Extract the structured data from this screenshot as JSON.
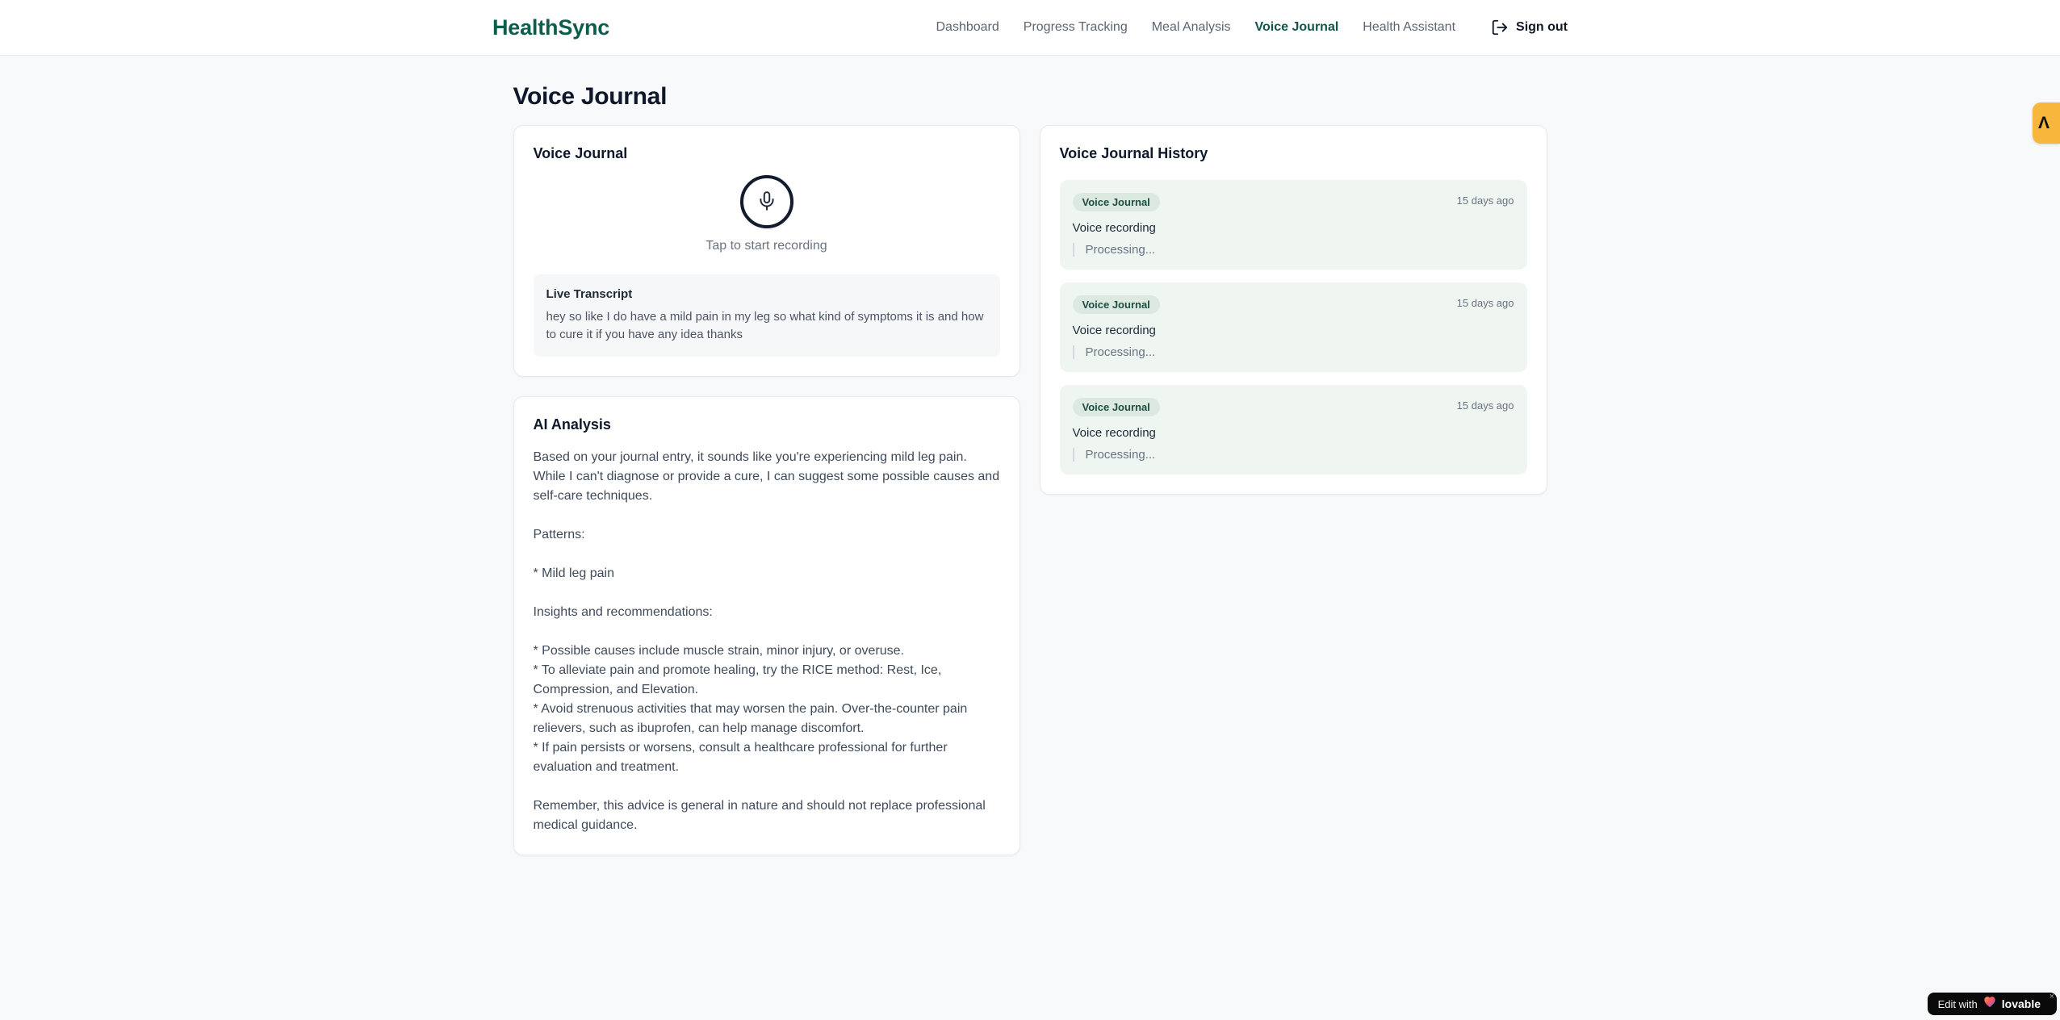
{
  "brand": {
    "name": "HealthSync",
    "color": "#0b5d4c"
  },
  "nav": {
    "items": [
      {
        "label": "Dashboard",
        "active": false
      },
      {
        "label": "Progress Tracking",
        "active": false
      },
      {
        "label": "Meal Analysis",
        "active": false
      },
      {
        "label": "Voice Journal",
        "active": true
      },
      {
        "label": "Health Assistant",
        "active": false
      }
    ],
    "signout_label": "Sign out"
  },
  "page": {
    "title": "Voice Journal"
  },
  "recorder_card": {
    "title": "Voice Journal",
    "tap_hint": "Tap to start recording",
    "transcript_title": "Live Transcript",
    "transcript_text": "hey so like I do have a mild pain in my leg so what kind of symptoms it is and how to cure it if you have any idea thanks"
  },
  "analysis_card": {
    "title": "AI Analysis",
    "body": "Based on your journal entry, it sounds like you're experiencing mild leg pain. While I can't diagnose or provide a cure, I can suggest some possible causes and self-care techniques.\n\nPatterns:\n\n* Mild leg pain\n\nInsights and recommendations:\n\n* Possible causes include muscle strain, minor injury, or overuse.\n* To alleviate pain and promote healing, try the RICE method: Rest, Ice, Compression, and Elevation.\n* Avoid strenuous activities that may worsen the pain. Over-the-counter pain relievers, such as ibuprofen, can help manage discomfort.\n* If pain persists or worsens, consult a healthcare professional for further evaluation and treatment.\n\nRemember, this advice is general in nature and should not replace professional medical guidance."
  },
  "history_card": {
    "title": "Voice Journal History",
    "entries": [
      {
        "badge": "Voice Journal",
        "time": "15 days ago",
        "title": "Voice recording",
        "status": "Processing..."
      },
      {
        "badge": "Voice Journal",
        "time": "15 days ago",
        "title": "Voice recording",
        "status": "Processing..."
      },
      {
        "badge": "Voice Journal",
        "time": "15 days ago",
        "title": "Voice recording",
        "status": "Processing..."
      }
    ]
  },
  "side_badge": {
    "glyph": "Λ",
    "color": "#f6b73c"
  },
  "edit_badge": {
    "prefix": "Edit with",
    "brand": "lovable",
    "close": "×"
  },
  "colors": {
    "entry_bg": "#eff6f1",
    "entry_badge_bg": "#dce9e1",
    "entry_badge_text": "#1d4e43",
    "mic_ring": "#141b2d",
    "header_border": "#e5e7eb"
  }
}
